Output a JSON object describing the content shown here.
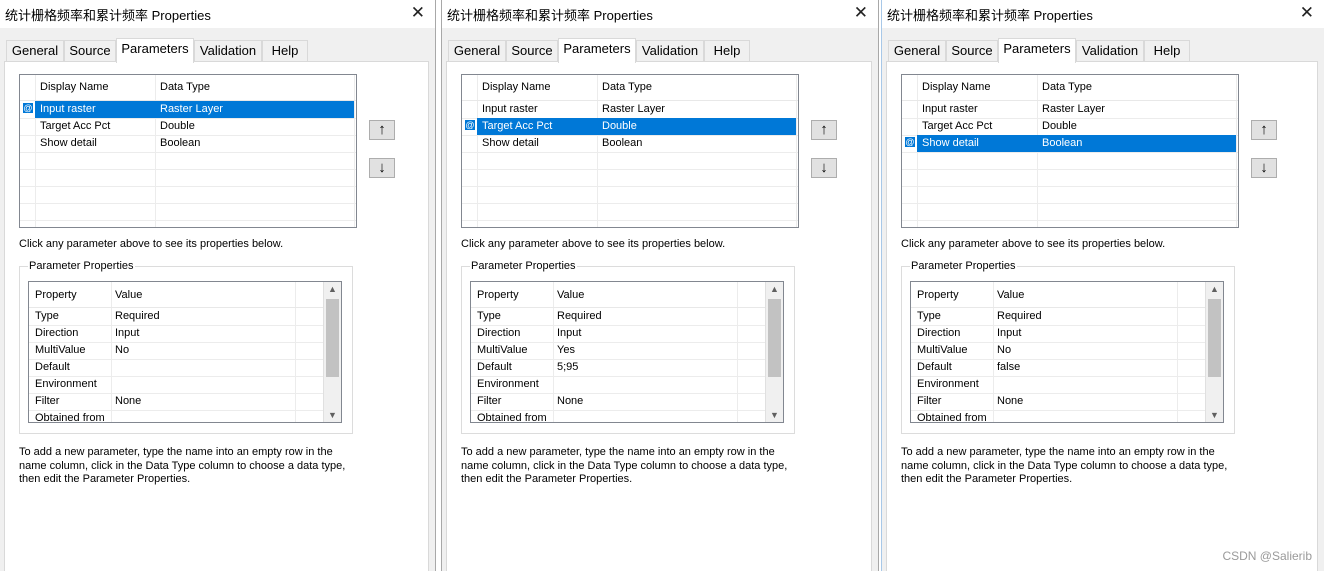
{
  "dialogs": [
    {
      "title": "统计栅格频率和累计频率 Properties",
      "tabs": [
        "General",
        "Source",
        "Parameters",
        "Validation",
        "Help"
      ],
      "active_tab": 2,
      "columns": [
        "Display Name",
        "Data Type"
      ],
      "parameters": [
        {
          "name": "Input raster",
          "type": "Raster Layer"
        },
        {
          "name": "Target Acc Pct",
          "type": "Double"
        },
        {
          "name": "Show detail",
          "type": "Boolean"
        }
      ],
      "selected_index": 0,
      "hint": "Click any parameter above to see its properties below.",
      "group_label": "Parameter Properties",
      "prop_columns": [
        "Property",
        "Value"
      ],
      "properties": [
        {
          "k": "Type",
          "v": "Required"
        },
        {
          "k": "Direction",
          "v": "Input"
        },
        {
          "k": "MultiValue",
          "v": "No"
        },
        {
          "k": "Default",
          "v": ""
        },
        {
          "k": "Environment",
          "v": ""
        },
        {
          "k": "Filter",
          "v": "None"
        },
        {
          "k": "Obtained from",
          "v": ""
        }
      ],
      "footer": "To add a new parameter, type the name into an empty row in the name column, click in the Data Type column to choose a data type, then edit the Parameter Properties."
    },
    {
      "title": "统计栅格频率和累计频率 Properties",
      "tabs": [
        "General",
        "Source",
        "Parameters",
        "Validation",
        "Help"
      ],
      "active_tab": 2,
      "columns": [
        "Display Name",
        "Data Type"
      ],
      "parameters": [
        {
          "name": "Input raster",
          "type": "Raster Layer"
        },
        {
          "name": "Target Acc Pct",
          "type": "Double"
        },
        {
          "name": "Show detail",
          "type": "Boolean"
        }
      ],
      "selected_index": 1,
      "hint": "Click any parameter above to see its properties below.",
      "group_label": "Parameter Properties",
      "prop_columns": [
        "Property",
        "Value"
      ],
      "properties": [
        {
          "k": "Type",
          "v": "Required"
        },
        {
          "k": "Direction",
          "v": "Input"
        },
        {
          "k": "MultiValue",
          "v": "Yes"
        },
        {
          "k": "Default",
          "v": "5;95"
        },
        {
          "k": "Environment",
          "v": ""
        },
        {
          "k": "Filter",
          "v": "None"
        },
        {
          "k": "Obtained from",
          "v": ""
        }
      ],
      "footer": "To add a new parameter, type the name into an empty row in the name column, click in the Data Type column to choose a data type, then edit the Parameter Properties."
    },
    {
      "title": "统计栅格频率和累计频率 Properties",
      "tabs": [
        "General",
        "Source",
        "Parameters",
        "Validation",
        "Help"
      ],
      "active_tab": 2,
      "columns": [
        "Display Name",
        "Data Type"
      ],
      "parameters": [
        {
          "name": "Input raster",
          "type": "Raster Layer"
        },
        {
          "name": "Target Acc Pct",
          "type": "Double"
        },
        {
          "name": "Show detail",
          "type": "Boolean"
        }
      ],
      "selected_index": 2,
      "hint": "Click any parameter above to see its properties below.",
      "group_label": "Parameter Properties",
      "prop_columns": [
        "Property",
        "Value"
      ],
      "properties": [
        {
          "k": "Type",
          "v": "Required"
        },
        {
          "k": "Direction",
          "v": "Input"
        },
        {
          "k": "MultiValue",
          "v": "No"
        },
        {
          "k": "Default",
          "v": "false"
        },
        {
          "k": "Environment",
          "v": ""
        },
        {
          "k": "Filter",
          "v": "None"
        },
        {
          "k": "Obtained from",
          "v": ""
        }
      ],
      "footer": "To add a new parameter, type the name into an empty row in the name column, click in the Data Type column to choose a data type, then edit the Parameter Properties."
    }
  ],
  "icons": {
    "close": "close-icon",
    "up": "arrow-up-icon",
    "down": "arrow-down-icon",
    "selected_marker": "row-indicator-icon"
  },
  "colors": {
    "selection": "#0078d7",
    "dialog_bg": "#f0f0f0",
    "page_bg": "#ffffff"
  },
  "watermark": "CSDN @Salierib"
}
